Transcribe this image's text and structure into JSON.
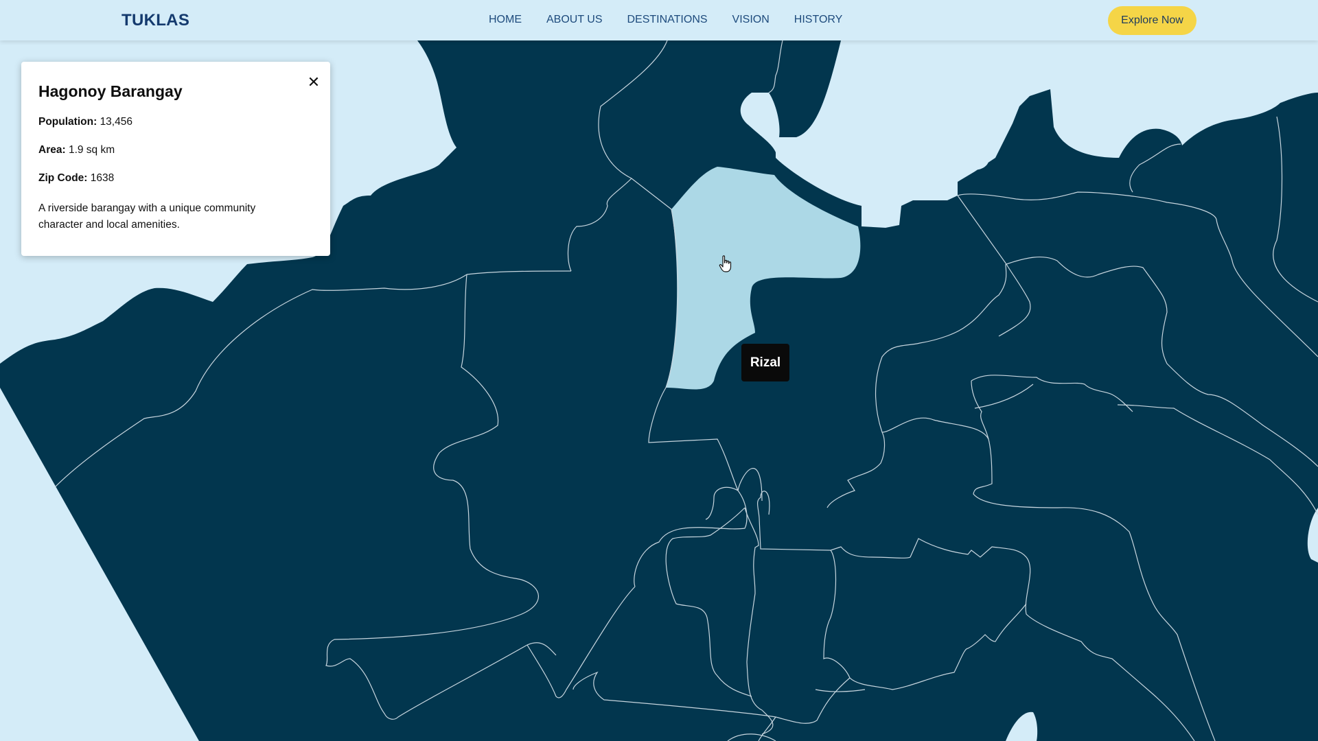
{
  "app": {
    "brand": "TUKLAS",
    "nav": [
      "HOME",
      "ABOUT US",
      "DESTINATIONS",
      "VISION",
      "HISTORY"
    ],
    "cta_label": "Explore Now"
  },
  "info_panel": {
    "title": "Hagonoy Barangay",
    "close_icon": "close-icon",
    "population_label": "Population:",
    "population_value": "13,456",
    "area_label": "Area:",
    "area_value": "1.9 sq km",
    "zip_label": "Zip Code:",
    "zip_value": "1638",
    "description": "A riverside barangay with a unique community character and local amenities."
  },
  "map": {
    "hover_tooltip": "Rizal",
    "cursor_icon": "hand-pointer-icon",
    "colors": {
      "water": "#d4ecf8",
      "land": "#02364e",
      "highlighted_region": "#acd8e6",
      "region_border": "#c8d6df"
    }
  },
  "colors": {
    "accent": "#f5d547",
    "brand_text": "#143a6e",
    "panel_bg": "#ffffff",
    "tooltip_bg": "#0a0a0a"
  }
}
